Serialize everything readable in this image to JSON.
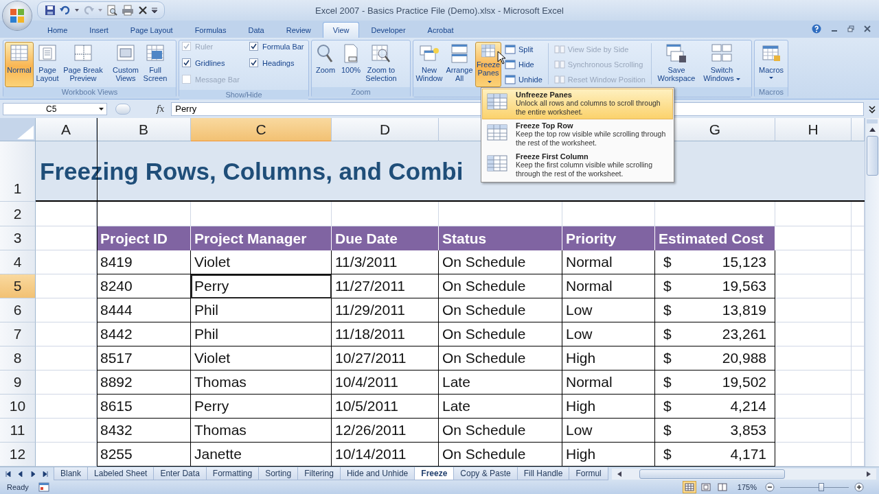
{
  "window": {
    "title": "Excel 2007 - Basics Practice File (Demo).xlsx - Microsoft Excel"
  },
  "ribbon_tabs": [
    {
      "label": "Home",
      "selected": false
    },
    {
      "label": "Insert",
      "selected": false
    },
    {
      "label": "Page Layout",
      "selected": false
    },
    {
      "label": "Formulas",
      "selected": false
    },
    {
      "label": "Data",
      "selected": false
    },
    {
      "label": "Review",
      "selected": false
    },
    {
      "label": "View",
      "selected": true
    },
    {
      "label": "Developer",
      "selected": false
    },
    {
      "label": "Acrobat",
      "selected": false
    }
  ],
  "workbook_views": {
    "label": "Workbook Views",
    "buttons": [
      {
        "label": "Normal",
        "selected": true
      },
      {
        "label": "Page Layout",
        "selected": false
      },
      {
        "label": "Page Break Preview",
        "selected": false
      },
      {
        "label": "Custom Views",
        "selected": false
      },
      {
        "label": "Full Screen",
        "selected": false
      }
    ]
  },
  "show_hide": {
    "label": "Show/Hide",
    "options": [
      {
        "label": "Ruler",
        "checked": true,
        "disabled": true
      },
      {
        "label": "Gridlines",
        "checked": true,
        "disabled": false
      },
      {
        "label": "Message Bar",
        "checked": false,
        "disabled": true
      },
      {
        "label": "Formula Bar",
        "checked": true,
        "disabled": false
      },
      {
        "label": "Headings",
        "checked": true,
        "disabled": false
      }
    ]
  },
  "zoom_group": {
    "label": "Zoom",
    "buttons": [
      {
        "label": "Zoom"
      },
      {
        "label": "100%"
      },
      {
        "label": "Zoom to Selection"
      }
    ]
  },
  "window_group": {
    "large_buttons": [
      {
        "label": "New Window",
        "pressed": false,
        "dropdown": false
      },
      {
        "label": "Arrange All",
        "pressed": false,
        "dropdown": false
      },
      {
        "label": "Freeze Panes",
        "pressed": true,
        "dropdown": true
      }
    ],
    "small_buttons": [
      {
        "label": "Split",
        "disabled": false
      },
      {
        "label": "Hide",
        "disabled": false
      },
      {
        "label": "Unhide",
        "disabled": false
      },
      {
        "label": "View Side by Side",
        "disabled": true
      },
      {
        "label": "Synchronous Scrolling",
        "disabled": true
      },
      {
        "label": "Reset Window Position",
        "disabled": true
      }
    ],
    "workspace_buttons": [
      {
        "label": "Save Workspace",
        "dropdown": false
      },
      {
        "label": "Switch Windows",
        "dropdown": true
      }
    ]
  },
  "macros_group": {
    "label": "Macros",
    "button": {
      "label": "Macros",
      "dropdown": true
    }
  },
  "formula_bar": {
    "name_box": "C5",
    "function_label": "fx",
    "value": "Perry"
  },
  "columns": [
    {
      "label": "A",
      "selected": false
    },
    {
      "label": "B",
      "selected": false
    },
    {
      "label": "C",
      "selected": true
    },
    {
      "label": "D",
      "selected": false
    },
    {
      "selected": false
    },
    {},
    {
      "label": "G",
      "selected": false
    },
    {
      "label": "H",
      "selected": false
    }
  ],
  "row_headers": [
    {
      "label": "1",
      "selected": false
    },
    {
      "label": "2",
      "selected": false
    },
    {
      "label": "3",
      "selected": false
    },
    {
      "label": "4",
      "selected": false
    },
    {
      "label": "5",
      "selected": true
    },
    {
      "label": "6",
      "selected": false
    },
    {
      "label": "7",
      "selected": false
    },
    {
      "label": "8",
      "selected": false
    },
    {
      "label": "9",
      "selected": false
    },
    {
      "label": "10",
      "selected": false
    },
    {
      "label": "11",
      "selected": false
    },
    {
      "label": "12",
      "selected": false
    }
  ],
  "sheet_title": "Freezing Rows, Columns, and Combi",
  "table": {
    "columns": [
      "Project ID",
      "Project Manager",
      "Due Date",
      "Status",
      "Priority",
      "Estimated Cost"
    ],
    "rows": [
      {
        "cells": [
          "8419",
          "Violet",
          "11/3/2011",
          "On Schedule",
          "Normal"
        ],
        "currency": "$",
        "cost": "15,123"
      },
      {
        "cells": [
          "8240",
          "Perry",
          "11/27/2011",
          "On Schedule",
          "Normal"
        ],
        "currency": "$",
        "cost": "19,563"
      },
      {
        "cells": [
          "8444",
          "Phil",
          "11/29/2011",
          "On Schedule",
          "Low"
        ],
        "currency": "$",
        "cost": "13,819"
      },
      {
        "cells": [
          "8442",
          "Phil",
          "11/18/2011",
          "On Schedule",
          "Low"
        ],
        "currency": "$",
        "cost": "23,261"
      },
      {
        "cells": [
          "8517",
          "Violet",
          "10/27/2011",
          "On Schedule",
          "High"
        ],
        "currency": "$",
        "cost": "20,988"
      },
      {
        "cells": [
          "8892",
          "Thomas",
          "10/4/2011",
          "Late",
          "Normal"
        ],
        "currency": "$",
        "cost": "19,502"
      },
      {
        "cells": [
          "8615",
          "Perry",
          "10/5/2011",
          "Late",
          "High"
        ],
        "currency": "$",
        "cost": "4,214"
      },
      {
        "cells": [
          "8432",
          "Thomas",
          "12/26/2011",
          "On Schedule",
          "Low"
        ],
        "currency": "$",
        "cost": "3,853"
      },
      {
        "cells": [
          "8255",
          "Janette",
          "10/14/2011",
          "On Schedule",
          "High"
        ],
        "currency": "$",
        "cost": "4,171"
      }
    ]
  },
  "freeze_menu": {
    "items": [
      {
        "title": "Unfreeze Panes",
        "description": "Unlock all rows and columns to scroll through the entire worksheet.",
        "selected": true
      },
      {
        "title": "Freeze Top Row",
        "description": "Keep the top row visible while scrolling through the rest of the worksheet.",
        "selected": false
      },
      {
        "title": "Freeze First Column",
        "description": "Keep the first column visible while scrolling through the rest of the worksheet.",
        "selected": false
      }
    ]
  },
  "sheet_tabs": [
    {
      "label": "Blank",
      "selected": false
    },
    {
      "label": "Labeled Sheet",
      "selected": false
    },
    {
      "label": "Enter Data",
      "selected": false
    },
    {
      "label": "Formatting",
      "selected": false
    },
    {
      "label": "Sorting",
      "selected": false
    },
    {
      "label": "Filtering",
      "selected": false
    },
    {
      "label": "Hide and Unhide",
      "selected": false
    },
    {
      "label": "Freeze",
      "selected": true
    },
    {
      "label": "Copy & Paste",
      "selected": false
    },
    {
      "label": "Fill Handle",
      "selected": false
    },
    {
      "label": "Formul",
      "selected": false
    }
  ],
  "status_bar": {
    "status": "Ready",
    "zoom": "175%",
    "zoom_slider": {
      "level": 0.6
    },
    "views": [
      {
        "selected": true
      },
      {
        "selected": false
      },
      {
        "selected": false
      }
    ]
  }
}
